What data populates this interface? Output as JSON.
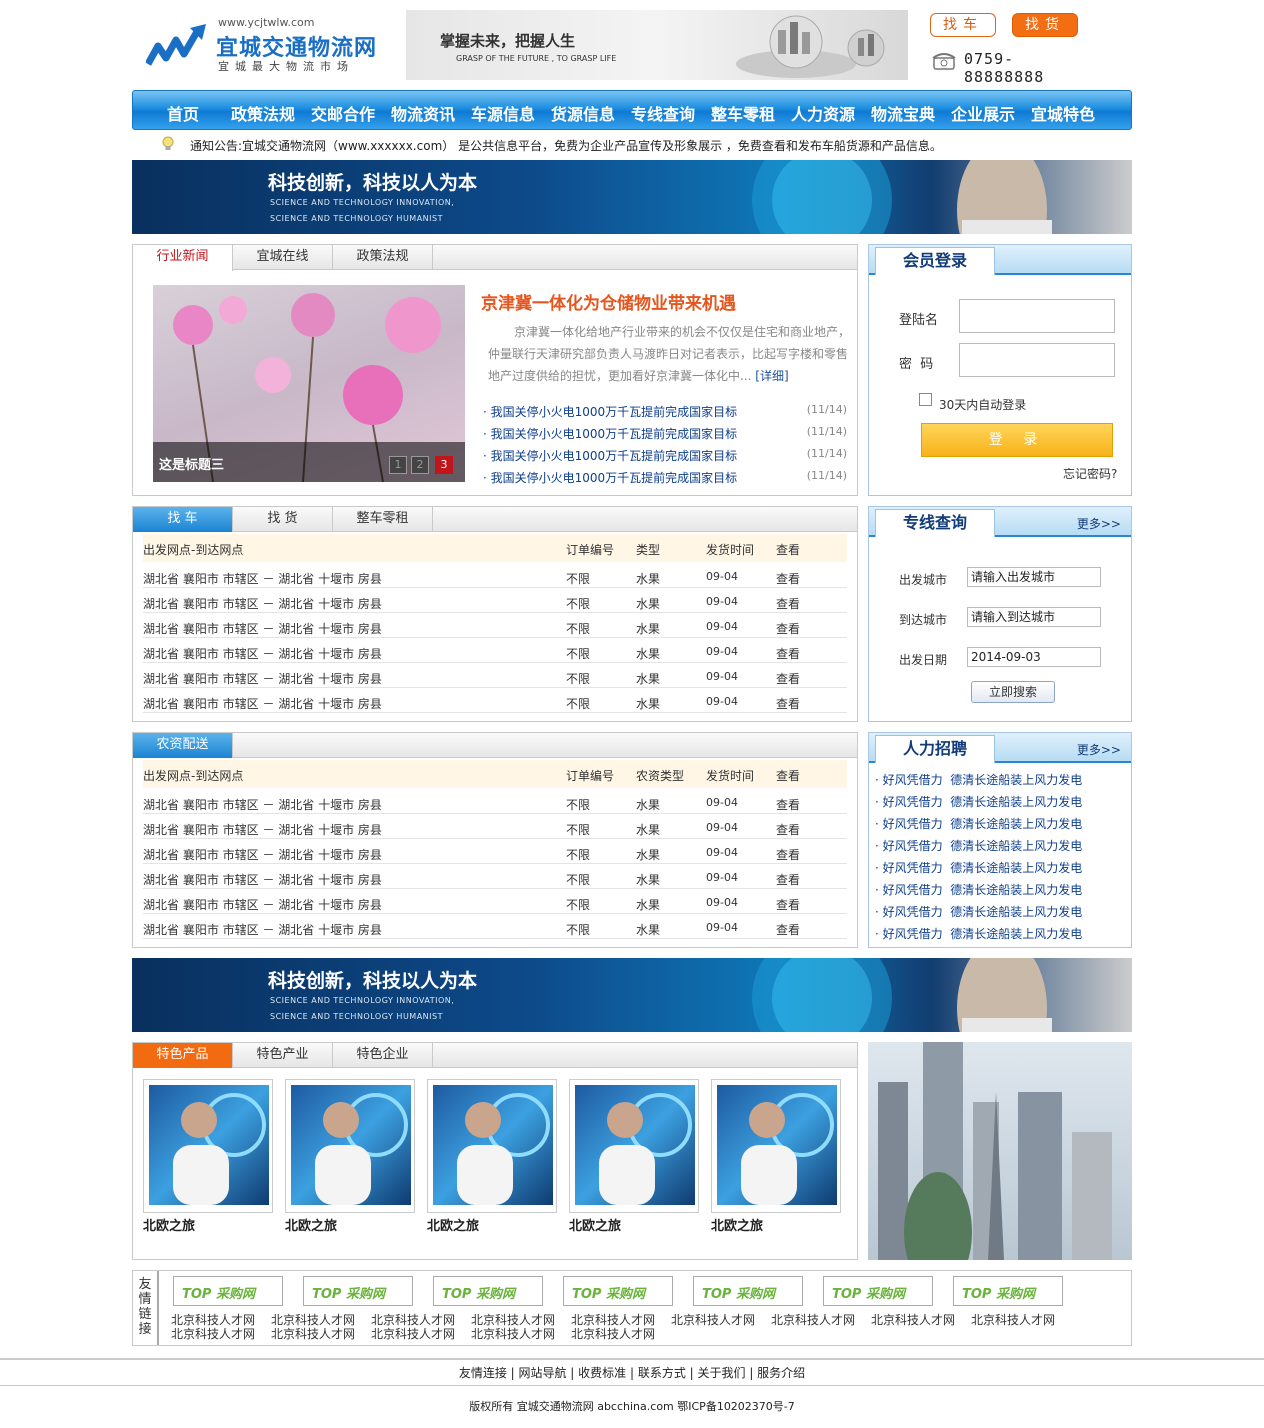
{
  "header": {
    "logo_url": "www.ycjtwlw.com",
    "logo_name": "宜城交通物流网",
    "logo_sub": "宜城最大物流市场",
    "banner_title": "掌握未来，把握人生",
    "banner_sub": "GRASP OF THE FUTURE , TO GRASP LIFE",
    "btn_car": "找车",
    "btn_goods": "找货",
    "phone": "0759-88888888"
  },
  "nav": [
    "首页",
    "政策法规",
    "交邮合作",
    "物流资讯",
    "车源信息",
    "货源信息",
    "专线查询",
    "整车零租",
    "人力资源",
    "物流宝典",
    "企业展示",
    "宜城特色"
  ],
  "notice": "通知公告:宜城交通物流网（www.xxxxxx.com） 是公共信息平台，免费为企业产品宣传及形象展示 ，免费查看和发布车船货源和产品信息。",
  "banner": {
    "title": "科技创新，科技以人为本",
    "en1": "SCIENCE AND TECHNOLOGY INNOVATION,",
    "en2": "SCIENCE AND TECHNOLOGY HUMANIST"
  },
  "news": {
    "tabs": [
      "行业新闻",
      "宜城在线",
      "政策法规"
    ],
    "caption": "这是标题三",
    "pages": [
      "1",
      "2",
      "3"
    ],
    "headline": "京津冀一体化为仓储物业带来机遇",
    "summary": "京津冀一体化给地产行业带来的机会不仅仅是住宅和商业地产，仲量联行天津研究部负责人马渡昨日对记者表示，比起写字楼和零售地产过度供给的担忧，更加看好京津冀一体化中...",
    "more": "[详细]",
    "items": [
      {
        "title": "· 我国关停小火电1000万千瓦提前完成国家目标",
        "date": "(11/14)"
      },
      {
        "title": "· 我国关停小火电1000万千瓦提前完成国家目标",
        "date": "(11/14)"
      },
      {
        "title": "· 我国关停小火电1000万千瓦提前完成国家目标",
        "date": "(11/14)"
      },
      {
        "title": "· 我国关停小火电1000万千瓦提前完成国家目标",
        "date": "(11/14)"
      }
    ]
  },
  "login": {
    "title": "会员登录",
    "username_label": "登陆名",
    "password_label": "密  码",
    "remember": "30天内自动登录",
    "submit": "登 录",
    "forgot": "忘记密码?"
  },
  "freight": {
    "tabs": [
      "找 车",
      "找 货",
      "整车零租"
    ],
    "headers": [
      "出发网点-到达网点",
      "订单编号",
      "类型",
      "发货时间",
      "查看"
    ],
    "rows": [
      [
        "湖北省 襄阳市 市辖区 － 湖北省 十堰市 房县",
        "不限",
        "水果",
        "09-04",
        "查看"
      ],
      [
        "湖北省 襄阳市 市辖区 － 湖北省 十堰市 房县",
        "不限",
        "水果",
        "09-04",
        "查看"
      ],
      [
        "湖北省 襄阳市 市辖区 － 湖北省 十堰市 房县",
        "不限",
        "水果",
        "09-04",
        "查看"
      ],
      [
        "湖北省 襄阳市 市辖区 － 湖北省 十堰市 房县",
        "不限",
        "水果",
        "09-04",
        "查看"
      ],
      [
        "湖北省 襄阳市 市辖区 － 湖北省 十堰市 房县",
        "不限",
        "水果",
        "09-04",
        "查看"
      ],
      [
        "湖北省 襄阳市 市辖区 － 湖北省 十堰市 房县",
        "不限",
        "水果",
        "09-04",
        "查看"
      ]
    ]
  },
  "agri": {
    "tabs": [
      "农资配送"
    ],
    "headers": [
      "出发网点-到达网点",
      "订单编号",
      "农资类型",
      "发货时间",
      "查看"
    ],
    "rows": [
      [
        "湖北省 襄阳市 市辖区 － 湖北省 十堰市 房县",
        "不限",
        "水果",
        "09-04",
        "查看"
      ],
      [
        "湖北省 襄阳市 市辖区 － 湖北省 十堰市 房县",
        "不限",
        "水果",
        "09-04",
        "查看"
      ],
      [
        "湖北省 襄阳市 市辖区 － 湖北省 十堰市 房县",
        "不限",
        "水果",
        "09-04",
        "查看"
      ],
      [
        "湖北省 襄阳市 市辖区 － 湖北省 十堰市 房县",
        "不限",
        "水果",
        "09-04",
        "查看"
      ],
      [
        "湖北省 襄阳市 市辖区 － 湖北省 十堰市 房县",
        "不限",
        "水果",
        "09-04",
        "查看"
      ],
      [
        "湖北省 襄阳市 市辖区 － 湖北省 十堰市 房县",
        "不限",
        "水果",
        "09-04",
        "查看"
      ]
    ]
  },
  "route": {
    "title": "专线查询",
    "more": "更多>>",
    "from_label": "出发城市",
    "from_value": "请输入出发城市",
    "to_label": "到达城市",
    "to_value": "请输入到达城市",
    "date_label": "出发日期",
    "date_value": "2014-09-03",
    "submit": "立即搜索"
  },
  "jobs": {
    "title": "人力招聘",
    "more": "更多>>",
    "items": [
      {
        "a": "· 好风凭借力",
        "b": "德清长途船装上风力发电"
      },
      {
        "a": "· 好风凭借力",
        "b": "德清长途船装上风力发电"
      },
      {
        "a": "· 好风凭借力",
        "b": "德清长途船装上风力发电"
      },
      {
        "a": "· 好风凭借力",
        "b": "德清长途船装上风力发电"
      },
      {
        "a": "· 好风凭借力",
        "b": "德清长途船装上风力发电"
      },
      {
        "a": "· 好风凭借力",
        "b": "德清长途船装上风力发电"
      },
      {
        "a": "· 好风凭借力",
        "b": "德清长途船装上风力发电"
      },
      {
        "a": "· 好风凭借力",
        "b": "德清长途船装上风力发电"
      }
    ]
  },
  "products": {
    "tabs": [
      "特色产品",
      "特色产业",
      "特色企业"
    ],
    "items": [
      "北欧之旅",
      "北欧之旅",
      "北欧之旅",
      "北欧之旅",
      "北欧之旅"
    ]
  },
  "links": {
    "label": "友情链接",
    "logo_text": "TOP 采购网",
    "texts": [
      "北京科技人才网",
      "北京科技人才网",
      "北京科技人才网",
      "北京科技人才网",
      "北京科技人才网",
      "北京科技人才网",
      "北京科技人才网",
      "北京科技人才网",
      "北京科技人才网"
    ],
    "texts2": [
      "北京科技人才网",
      "北京科技人才网",
      "北京科技人才网",
      "北京科技人才网",
      "北京科技人才网"
    ]
  },
  "footer": {
    "links": "友情连接 | 网站导航 | 收费标准 | 联系方式 | 关于我们 | 服务介绍",
    "copyright": "版权所有 宜城交通物流网 abcchina.com 鄂ICP备10202370号-7"
  }
}
